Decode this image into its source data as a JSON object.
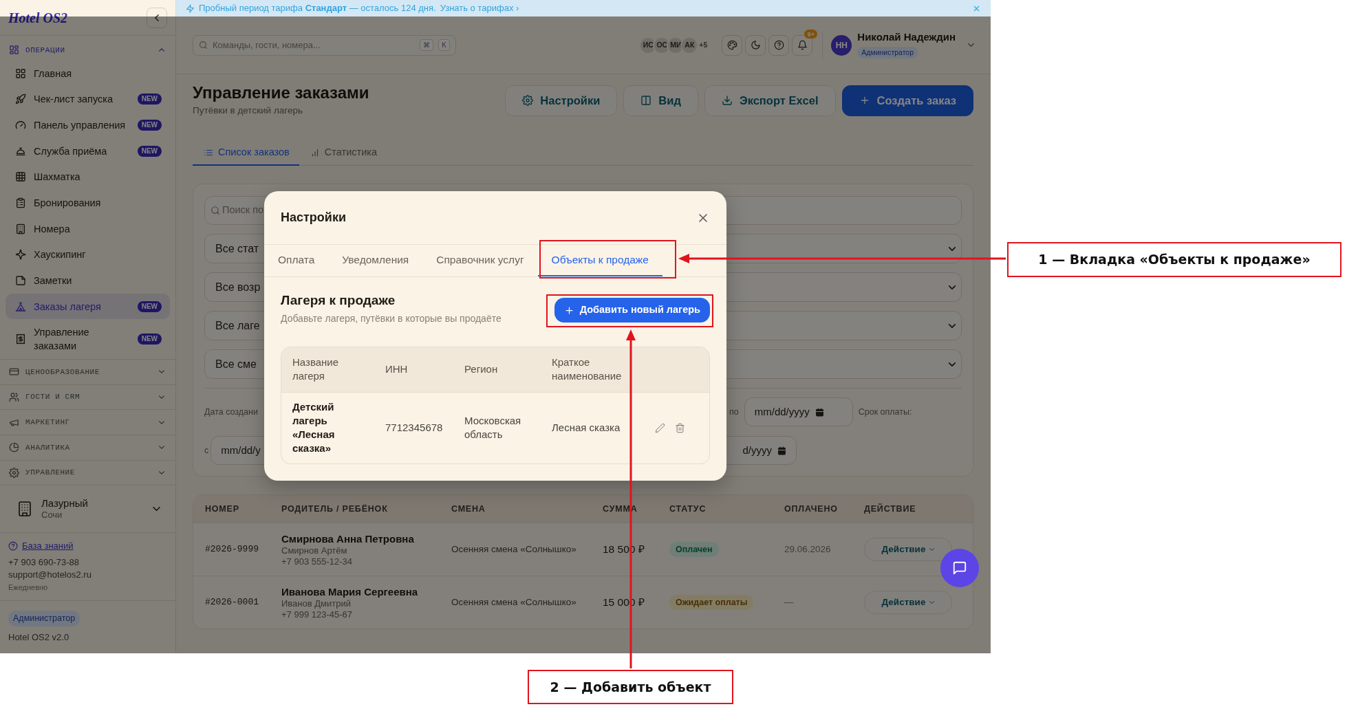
{
  "banner": {
    "text": "Пробный период тарифа **Стандарт** — осталось 124 дня.",
    "link": "Узнать о тарифах ›"
  },
  "sidebar": {
    "logo": "Hotel OS2",
    "sections": [
      {
        "title": "ОПЕРАЦИИ",
        "expanded": true,
        "items": [
          {
            "label": "Главная",
            "selected": false
          },
          {
            "label": "Чек-лист запуска",
            "badge": "NEW",
            "selected": false
          },
          {
            "label": "Панель управления",
            "badge": "NEW",
            "selected": false
          },
          {
            "label": "Служба приёма",
            "badge": "NEW",
            "selected": false
          },
          {
            "label": "Шахматка",
            "selected": false
          },
          {
            "label": "Бронирования",
            "selected": false
          },
          {
            "label": "Номера",
            "selected": false
          },
          {
            "label": "Хаускипинг",
            "selected": false
          },
          {
            "label": "Заметки",
            "selected": false
          },
          {
            "label": "Заказы лагеря",
            "badge": "NEW",
            "selected": true
          },
          {
            "label": "Управление заказами",
            "badge": "NEW",
            "selected": false
          }
        ]
      },
      {
        "title": "ЦЕНООБРАЗОВАНИЕ",
        "expanded": false
      },
      {
        "title": "ГОСТИ И CRM",
        "expanded": false
      },
      {
        "title": "МАРКЕТИНГ",
        "expanded": false
      },
      {
        "title": "АНАЛИТИКА",
        "expanded": false
      },
      {
        "title": "УПРАВЛЕНИЕ",
        "expanded": false
      }
    ],
    "hotel": {
      "name": "Лазурный",
      "city": "Сочи"
    },
    "support": {
      "knowledge_base": "База знаний",
      "phone": "+7 903 690-73-88",
      "email": "support@hotelos2.ru",
      "hours": "Ежедневно"
    },
    "role": "Администратор",
    "version": "Hotel OS2 v2.0"
  },
  "topbar": {
    "search_placeholder": "Команды, гости, номера...",
    "shortcut": [
      "⌘",
      "K"
    ],
    "presence": [
      "ИС",
      "ОС",
      "МИ",
      "АК",
      "+5"
    ],
    "notifications": "9+",
    "user": {
      "initials": "НН",
      "name": "Николай Надеждин",
      "role": "Администратор"
    }
  },
  "page": {
    "title": "Управление заказами",
    "subtitle": "Путёвки в детский лагерь",
    "buttons": [
      {
        "label": "Настройки",
        "kind": "light"
      },
      {
        "label": "Вид",
        "kind": "light"
      },
      {
        "label": "Экспорт Excel",
        "kind": "light"
      },
      {
        "label": "Создать заказ",
        "kind": "primary"
      }
    ],
    "tabs": [
      {
        "label": "Список заказов",
        "selected": true
      },
      {
        "label": "Статистика",
        "selected": false
      }
    ]
  },
  "filters": {
    "search_placeholder": "Поиск по",
    "selects": [
      "Все стат",
      "Все возр",
      "Все лаге",
      "Все сме"
    ],
    "created_label": "Дата создани",
    "from_label": "с",
    "from_placeholder": "mm/dd/y",
    "to_label": "по",
    "to_placeholder": "mm/dd/yyyy",
    "due_label": "Срок оплаты:",
    "due_to_placeholder": "d/yyyy"
  },
  "orders": {
    "columns": [
      "НОМЕР",
      "РОДИТЕЛЬ / РЕБЁНОК",
      "СМЕНА",
      "СУММА",
      "СТАТУС",
      "ОПЛАЧЕНО",
      "ДЕЙСТВИЕ"
    ],
    "rows": [
      {
        "number": "#2026-9999",
        "parent": "Смирнова Анна Петровна",
        "child": "Смирнов Артём",
        "phone": "+7 903 555-12-34",
        "shift": "Осенняя смена «Солнышко»",
        "sum": "18 500 ₽",
        "status": {
          "text": "Оплачен",
          "kind": "paid"
        },
        "paid": "29.06.2026",
        "action": "Действие"
      },
      {
        "number": "#2026-0001",
        "parent": "Иванова Мария Сергеевна",
        "child": "Иванов Дмитрий",
        "phone": "+7 999 123-45-67",
        "shift": "Осенняя смена «Солнышко»",
        "sum": "15 000 ₽",
        "status": {
          "text": "Ожидает оплаты",
          "kind": "pending"
        },
        "paid": "—",
        "action": "Действие"
      }
    ]
  },
  "modal": {
    "title": "Настройки",
    "tabs": [
      {
        "label": "Оплата",
        "selected": false
      },
      {
        "label": "Уведомления",
        "selected": false
      },
      {
        "label": "Справочник услуг",
        "selected": false
      },
      {
        "label": "Объекты к продаже",
        "selected": true
      }
    ],
    "section_title": "Лагеря к продаже",
    "section_subtitle": "Добавьте лагеря, путёвки в которые вы продаёте",
    "add_button": "Добавить новый лагерь",
    "table": {
      "columns": [
        "Название лагеря",
        "ИНН",
        "Регион",
        "Краткое наименование"
      ],
      "rows": [
        {
          "name": "Детский лагерь «Лесная сказка»",
          "inn": "7712345678",
          "region": "Московская область",
          "short_name": "Лесная сказка"
        }
      ]
    }
  },
  "annotations": [
    {
      "text": "1 — Вкладка «Объекты к продаже»"
    },
    {
      "text": "2 — Добавить объект"
    }
  ]
}
